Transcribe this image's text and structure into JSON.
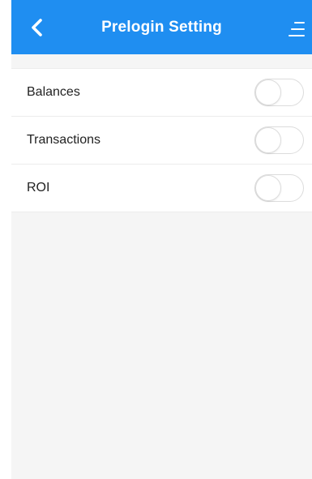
{
  "header": {
    "title": "Prelogin Setting",
    "back_icon": "chevron-left-icon",
    "menu_icon": "menu-icon",
    "color": "#1f8ef1"
  },
  "settings": {
    "items": [
      {
        "label": "Balances",
        "enabled": false
      },
      {
        "label": "Transactions",
        "enabled": false
      },
      {
        "label": "ROI",
        "enabled": false
      }
    ]
  }
}
